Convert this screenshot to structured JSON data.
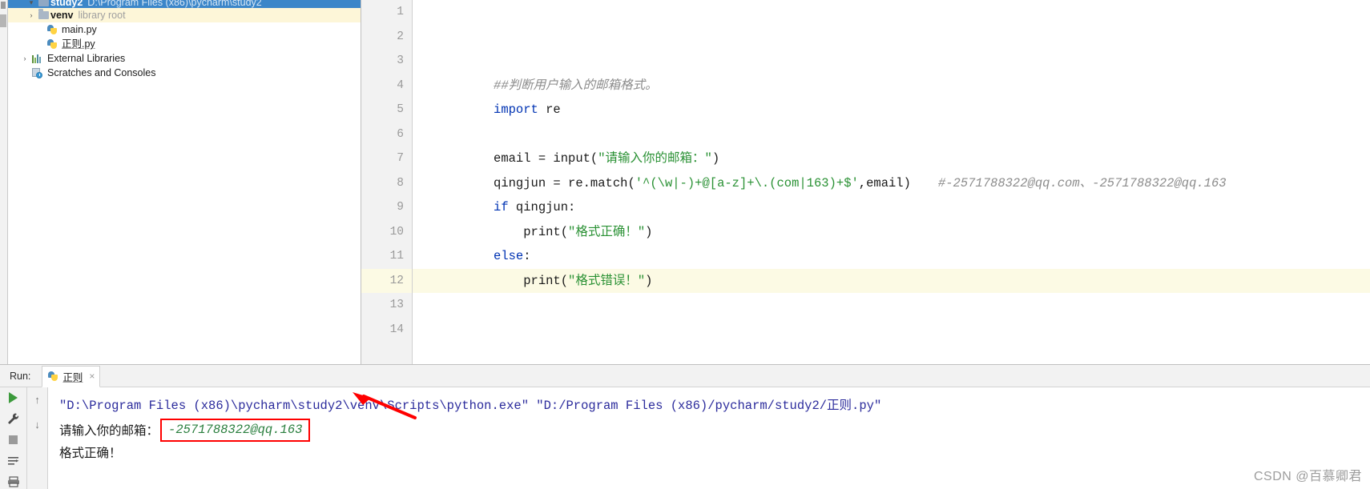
{
  "app": {
    "ide": "PyCharm",
    "accent_blue": "#3b86c9",
    "highlight_yellow": "#fdf6d8",
    "annotation_red": "#ff0000"
  },
  "project_tree": {
    "items": [
      {
        "label": "study2",
        "sub": "D:\\Program Files (x86)\\pycharm\\study2",
        "icon": "folder-icon",
        "indent": 0,
        "twisty": "▾",
        "state": "selected"
      },
      {
        "label": "venv",
        "sub": "library root",
        "icon": "folder-icon",
        "indent": 1,
        "twisty": "›",
        "state": "highlight"
      },
      {
        "label": "main.py",
        "sub": "",
        "icon": "python-file-icon",
        "indent": 2,
        "twisty": "",
        "state": "normal"
      },
      {
        "label": "正则.py",
        "sub": "",
        "icon": "python-file-icon",
        "indent": 2,
        "twisty": "",
        "state": "normal"
      },
      {
        "label": "External Libraries",
        "sub": "",
        "icon": "library-icon",
        "indent": 0,
        "twisty": "›",
        "state": "normal"
      },
      {
        "label": "Scratches and Consoles",
        "sub": "",
        "icon": "scratches-icon",
        "indent": 0,
        "twisty": "",
        "state": "normal"
      }
    ]
  },
  "editor": {
    "line_numbers": [
      "1",
      "2",
      "3",
      "4",
      "5",
      "6",
      "7",
      "8",
      "9",
      "10",
      "11",
      "12",
      "13",
      "14"
    ],
    "current_line": 12,
    "lines": [
      {
        "n": "1",
        "text": ""
      },
      {
        "n": "2",
        "text": ""
      },
      {
        "n": "3",
        "text": "##判断用户输入的邮箱格式。"
      },
      {
        "n": "4",
        "text": "import re"
      },
      {
        "n": "5",
        "text": ""
      },
      {
        "n": "6",
        "text": "email = input(\"请输入你的邮箱：\")"
      },
      {
        "n": "7",
        "text": "qingjun = re.match('^(\\w|-)+@[a-z]+\\.(com|163)+$',email)    #-2571788322@qq.com、-2571788322@qq.163"
      },
      {
        "n": "8",
        "text": "if qingjun:"
      },
      {
        "n": "9",
        "text": "    print(\"格式正确！\")"
      },
      {
        "n": "10",
        "text": "else:"
      },
      {
        "n": "11",
        "text": "    print(\"格式错误！\")"
      },
      {
        "n": "12",
        "text": ""
      },
      {
        "n": "13",
        "text": ""
      },
      {
        "n": "14",
        "text": ""
      }
    ],
    "tokens": {
      "line3_comment": "##判断用户输入的邮箱格式。",
      "line4_kw": "import",
      "line4_mod": " re",
      "line6_a": "email = input(",
      "line6_str": "\"请输入你的邮箱：\"",
      "line6_b": ")",
      "line7_a": "qingjun = re.match(",
      "line7_str": "'^(\\w|-)+@[a-z]+\\.(com|163)+$'",
      "line7_b": ",email)",
      "line7_comment": "#-2571788322@qq.com、-2571788322@qq.163",
      "line8_kw": "if",
      "line8_rest": " qingjun:",
      "line9_a": "    print(",
      "line9_str": "\"格式正确！\"",
      "line9_b": ")",
      "line10_kw": "else",
      "line10_rest": ":",
      "line11_a": "    print(",
      "line11_str": "\"格式错误！\"",
      "line11_b": ")"
    }
  },
  "run_panel": {
    "run_label": "Run:",
    "tab_name": "正则",
    "tab_close": "×",
    "tools": {
      "run_button": "run-button",
      "settings_button": "wrench-icon",
      "stop_button": "stop-icon",
      "soft_wrap_button": "soft-wrap-icon",
      "print_button": "print-icon",
      "scroll_up_button": "↑",
      "scroll_down_button": "↓"
    },
    "console": {
      "command_line": "\"D:\\Program Files (x86)\\pycharm\\study2\\venv\\Scripts\\python.exe\" \"D:/Program Files (x86)/pycharm/study2/正则.py\"",
      "prompt_text": "请输入你的邮箱：",
      "user_input": "-2571788322@qq.163",
      "result_text": "格式正确！"
    }
  },
  "watermark": "CSDN @百慕卿君"
}
